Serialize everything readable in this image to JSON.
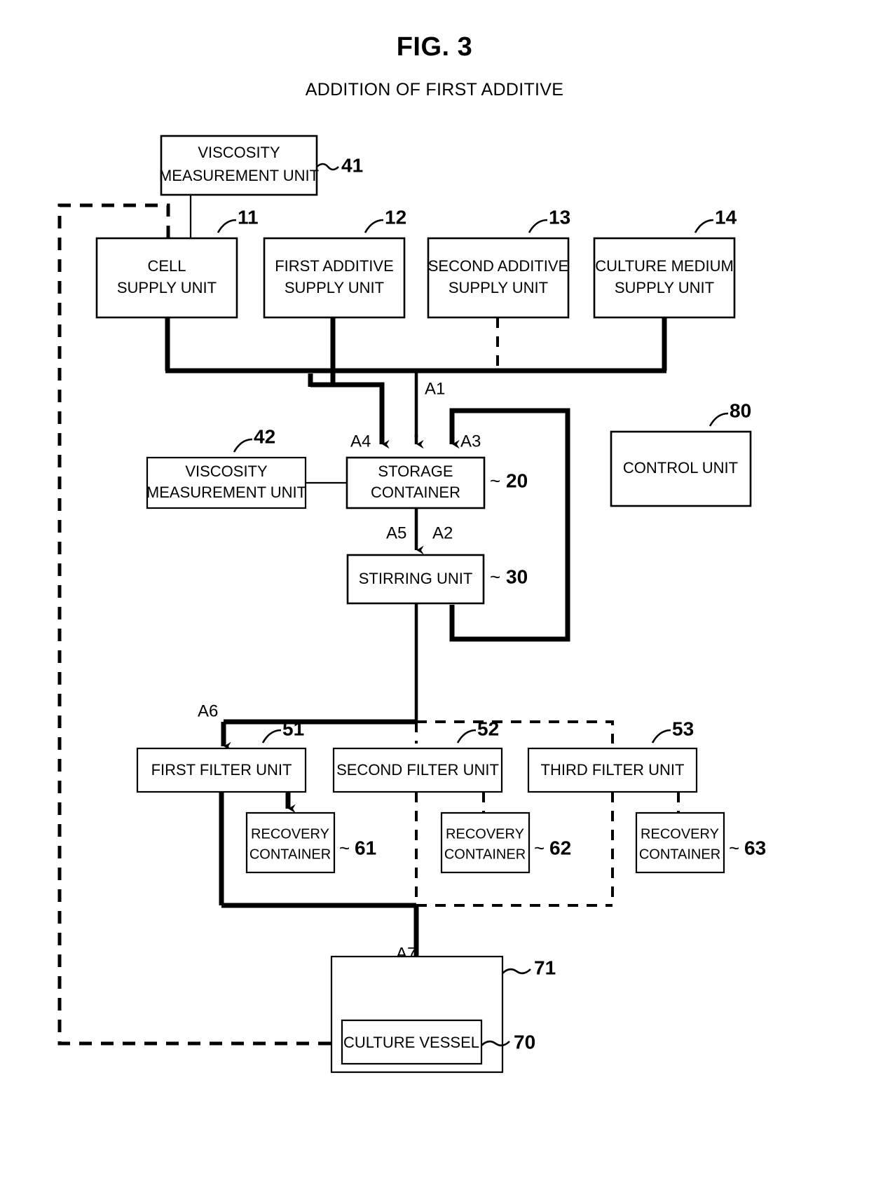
{
  "figure": {
    "title": "FIG. 3",
    "subtitle": "ADDITION OF FIRST ADDITIVE"
  },
  "nodes": {
    "viscosity41": {
      "line1": "VISCOSITY",
      "line2": "MEASUREMENT UNIT",
      "ref": "41"
    },
    "cell_supply": {
      "line1": "CELL",
      "line2": "SUPPLY UNIT",
      "ref": "11"
    },
    "first_additive": {
      "line1": "FIRST ADDITIVE",
      "line2": "SUPPLY UNIT",
      "ref": "12"
    },
    "second_additive": {
      "line1": "SECOND ADDITIVE",
      "line2": "SUPPLY UNIT",
      "ref": "13"
    },
    "culture_medium": {
      "line1": "CULTURE MEDIUM",
      "line2": "SUPPLY UNIT",
      "ref": "14"
    },
    "viscosity42": {
      "line1": "VISCOSITY",
      "line2": "MEASUREMENT UNIT",
      "ref": "42"
    },
    "storage": {
      "line1": "STORAGE",
      "line2": "CONTAINER",
      "ref": "20"
    },
    "control": {
      "line1": "CONTROL UNIT",
      "ref": "80"
    },
    "stirring": {
      "line1": "STIRRING UNIT",
      "ref": "30"
    },
    "filter1": {
      "line1": "FIRST FILTER UNIT",
      "ref": "51"
    },
    "filter2": {
      "line1": "SECOND FILTER UNIT",
      "ref": "52"
    },
    "filter3": {
      "line1": "THIRD FILTER UNIT",
      "ref": "53"
    },
    "recovery1": {
      "line1": "RECOVERY",
      "line2": "CONTAINER",
      "ref": "61"
    },
    "recovery2": {
      "line1": "RECOVERY",
      "line2": "CONTAINER",
      "ref": "62"
    },
    "recovery3": {
      "line1": "RECOVERY",
      "line2": "CONTAINER",
      "ref": "63"
    },
    "culture_vessel": {
      "line1": "CULTURE VESSEL",
      "ref": "70",
      "outer_ref": "71"
    }
  },
  "flow_labels": {
    "a1": "A1",
    "a2": "A2",
    "a3": "A3",
    "a4": "A4",
    "a5": "A5",
    "a6": "A6",
    "a7": "A7"
  },
  "tilde": "~",
  "colors": {
    "stroke": "#000000",
    "background": "#ffffff"
  }
}
